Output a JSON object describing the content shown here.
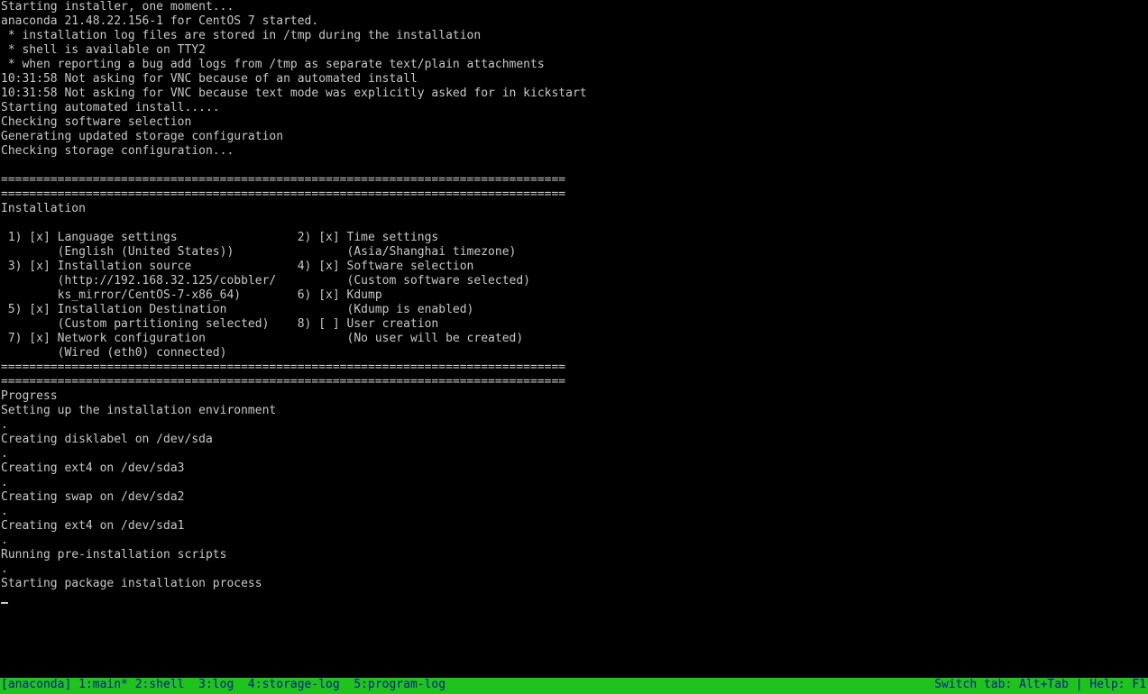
{
  "terminal": {
    "lines": [
      "Starting installer, one moment...",
      "anaconda 21.48.22.156-1 for CentOS 7 started.",
      " * installation log files are stored in /tmp during the installation",
      " * shell is available on TTY2",
      " * when reporting a bug add logs from /tmp as separate text/plain attachments",
      "10:31:58 Not asking for VNC because of an automated install",
      "10:31:58 Not asking for VNC because text mode was explicitly asked for in kickstart",
      "Starting automated install.....",
      "Checking software selection",
      "Generating updated storage configuration",
      "Checking storage configuration...",
      "",
      "================================================================================",
      "================================================================================",
      "Installation",
      "",
      " 1) [x] Language settings                 2) [x] Time settings",
      "        (English (United States))                (Asia/Shanghai timezone)",
      " 3) [x] Installation source               4) [x] Software selection",
      "        (http://192.168.32.125/cobbler/          (Custom software selected)",
      "        ks_mirror/CentOS-7-x86_64)        6) [x] Kdump",
      " 5) [x] Installation Destination                 (Kdump is enabled)",
      "        (Custom partitioning selected)    8) [ ] User creation",
      " 7) [x] Network configuration                    (No user will be created)",
      "        (Wired (eth0) connected)",
      "================================================================================",
      "================================================================================",
      "Progress",
      "Setting up the installation environment",
      ".",
      "Creating disklabel on /dev/sda",
      ".",
      "Creating ext4 on /dev/sda3",
      ".",
      "Creating swap on /dev/sda2",
      ".",
      "Creating ext4 on /dev/sda1",
      ".",
      "Running pre-installation scripts",
      ".",
      "Starting package installation process"
    ]
  },
  "statusbar": {
    "left": "[anaconda] 1:main* 2:shell  3:log  4:storage-log  5:program-log",
    "right": "Switch tab: Alt+Tab | Help: F1"
  },
  "colors": {
    "background": "#000000",
    "text": "#c8c8c8",
    "statusbar_bg": "#1ec31e",
    "statusbar_text": "#0a1e8c"
  }
}
